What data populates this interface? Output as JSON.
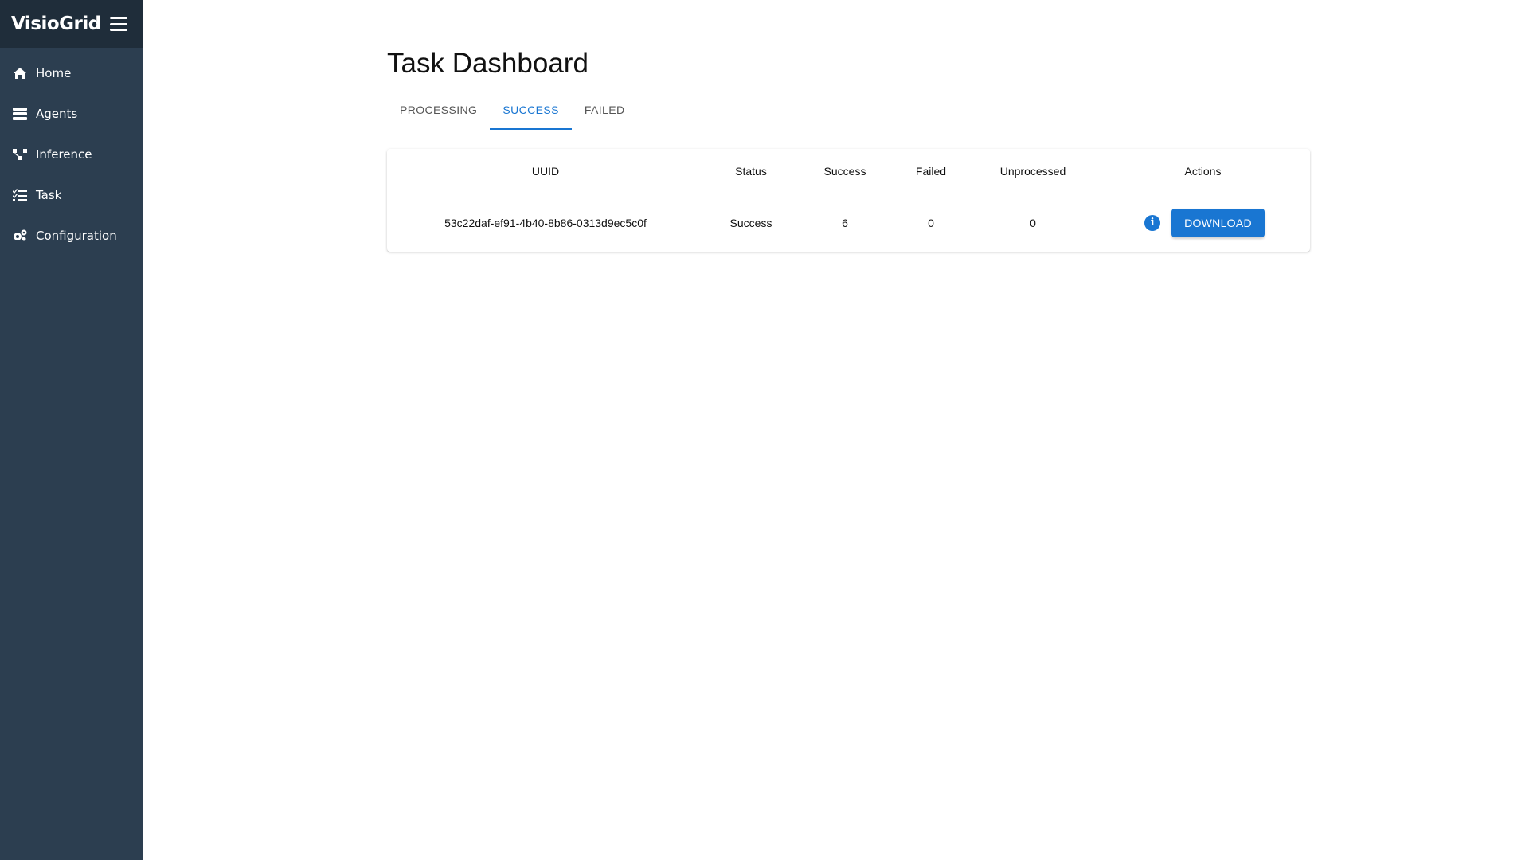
{
  "sidebar": {
    "brand": "VisioGrid",
    "items": [
      {
        "label": "Home",
        "icon": "home-icon"
      },
      {
        "label": "Agents",
        "icon": "server-icon"
      },
      {
        "label": "Inference",
        "icon": "network-icon"
      },
      {
        "label": "Task",
        "icon": "tasks-icon"
      },
      {
        "label": "Configuration",
        "icon": "cogs-icon"
      }
    ]
  },
  "main": {
    "title": "Task Dashboard",
    "tabs": [
      {
        "label": "PROCESSING",
        "active": false
      },
      {
        "label": "SUCCESS",
        "active": true
      },
      {
        "label": "FAILED",
        "active": false
      }
    ],
    "table": {
      "columns": [
        "UUID",
        "Status",
        "Success",
        "Failed",
        "Unprocessed",
        "Actions"
      ],
      "rows": [
        {
          "uuid": "53c22daf-ef91-4b40-8b86-0313d9ec5c0f",
          "status": "Success",
          "success": "6",
          "failed": "0",
          "unprocessed": "0",
          "info_icon": "info-icon",
          "download_label": "DOWNLOAD"
        }
      ]
    }
  },
  "colors": {
    "sidebar_bg": "#2c3e50",
    "sidebar_header_bg": "#1f2d3a",
    "accent": "#1976d2"
  }
}
